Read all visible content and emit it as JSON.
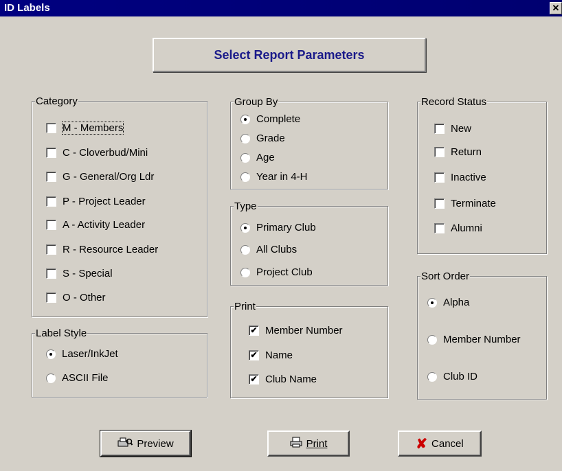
{
  "window": {
    "title": "ID Labels",
    "close": "✕"
  },
  "banner": "Select Report Parameters",
  "category": {
    "legend": "Category",
    "items": [
      {
        "label": "M - Members",
        "checked": false
      },
      {
        "label": "C - Cloverbud/Mini",
        "checked": false
      },
      {
        "label": "G - General/Org Ldr",
        "checked": false
      },
      {
        "label": "P - Project Leader",
        "checked": false
      },
      {
        "label": "A - Activity Leader",
        "checked": false
      },
      {
        "label": "R - Resource Leader",
        "checked": false
      },
      {
        "label": "S - Special",
        "checked": false
      },
      {
        "label": "O - Other",
        "checked": false
      }
    ]
  },
  "label_style": {
    "legend": "Label Style",
    "items": [
      {
        "label": "Laser/InkJet",
        "selected": true
      },
      {
        "label": "ASCII File",
        "selected": false
      }
    ]
  },
  "group_by": {
    "legend": "Group By",
    "items": [
      {
        "label": "Complete",
        "selected": true
      },
      {
        "label": "Grade",
        "selected": false
      },
      {
        "label": "Age",
        "selected": false
      },
      {
        "label": "Year in 4-H",
        "selected": false
      }
    ]
  },
  "type": {
    "legend": "Type",
    "items": [
      {
        "label": "Primary Club",
        "selected": true
      },
      {
        "label": "All Clubs",
        "selected": false
      },
      {
        "label": "Project Club",
        "selected": false
      }
    ]
  },
  "print": {
    "legend": "Print",
    "items": [
      {
        "label": "Member Number",
        "checked": true
      },
      {
        "label": "Name",
        "checked": true
      },
      {
        "label": "Club Name",
        "checked": true
      }
    ]
  },
  "record_status": {
    "legend": "Record Status",
    "items": [
      {
        "label": "New",
        "checked": false
      },
      {
        "label": "Return",
        "checked": false
      },
      {
        "label": "Inactive",
        "checked": false
      },
      {
        "label": "Terminate",
        "checked": false
      },
      {
        "label": "Alumni",
        "checked": false
      }
    ]
  },
  "sort_order": {
    "legend": "Sort Order",
    "items": [
      {
        "label": "Alpha",
        "selected": true
      },
      {
        "label": "Member Number",
        "selected": false
      },
      {
        "label": "Club ID",
        "selected": false
      }
    ]
  },
  "buttons": {
    "preview": "Preview",
    "print": "Print",
    "cancel": "Cancel"
  },
  "colors": {
    "titlebar": "#000080",
    "banner_text": "#1a1a8a",
    "cancel_icon": "#cc0000"
  }
}
